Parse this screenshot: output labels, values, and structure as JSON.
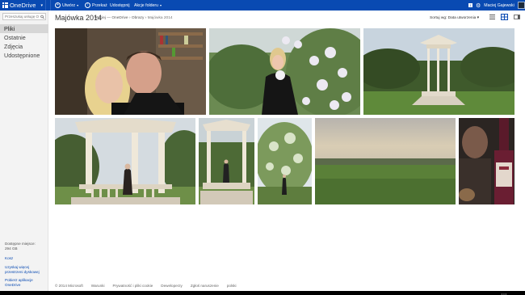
{
  "topbar": {
    "app_name": "OneDrive",
    "create_label": "Utwórz",
    "upload_label": "Przekaż",
    "share_label": "Udostępnij",
    "folder_actions_label": "Akcje folderu",
    "notifications_count": "1",
    "user_name": "Maciej Gajewski",
    "bar_color": "#094ab2"
  },
  "sidebar": {
    "search_placeholder": "Przeszukaj usługę O",
    "items": [
      {
        "label": "Pliki",
        "active": true
      },
      {
        "label": "Ostatnie",
        "active": false
      },
      {
        "label": "Zdjęcia",
        "active": false
      },
      {
        "label": "Udostępnione",
        "active": false
      }
    ],
    "quota_label": "Dostępne miejsce:",
    "quota_value": "294 GB",
    "trash_label": "Kosz",
    "more_storage_label_1": "Uzyskaj więcej",
    "more_storage_label_2": "przestrzeni dyskowej",
    "apps_label_1": "Pobierz aplikacje",
    "apps_label_2": "OneDrive"
  },
  "main": {
    "folder_title": "Majówka 2014",
    "breadcrumb": [
      "Maciej — OneDrive",
      "Obrazy",
      "Majówka 2014"
    ],
    "sort_label": "Sortuj wg: Data utworzenia",
    "photos": [
      {
        "name": "photo-couple-selfie",
        "scene": "selfie"
      },
      {
        "name": "photo-woman-lilacs",
        "scene": "lilac"
      },
      {
        "name": "photo-gazebo-wide",
        "scene": "gazebo"
      },
      {
        "name": "photo-gazebo-woman",
        "scene": "gazebo2"
      },
      {
        "name": "photo-gazebo-portrait",
        "scene": "gazebo3"
      },
      {
        "name": "photo-blossoming-tree",
        "scene": "tree"
      },
      {
        "name": "photo-meadow-sunset",
        "scene": "meadow"
      },
      {
        "name": "photo-party-bottle",
        "scene": "party"
      }
    ]
  },
  "footer": {
    "links": [
      "© 2014 Microsoft",
      "Warunki",
      "Prywatność i pliki cookie",
      "Deweloperzy",
      "Zgłoś naruszenie",
      "polski"
    ]
  }
}
